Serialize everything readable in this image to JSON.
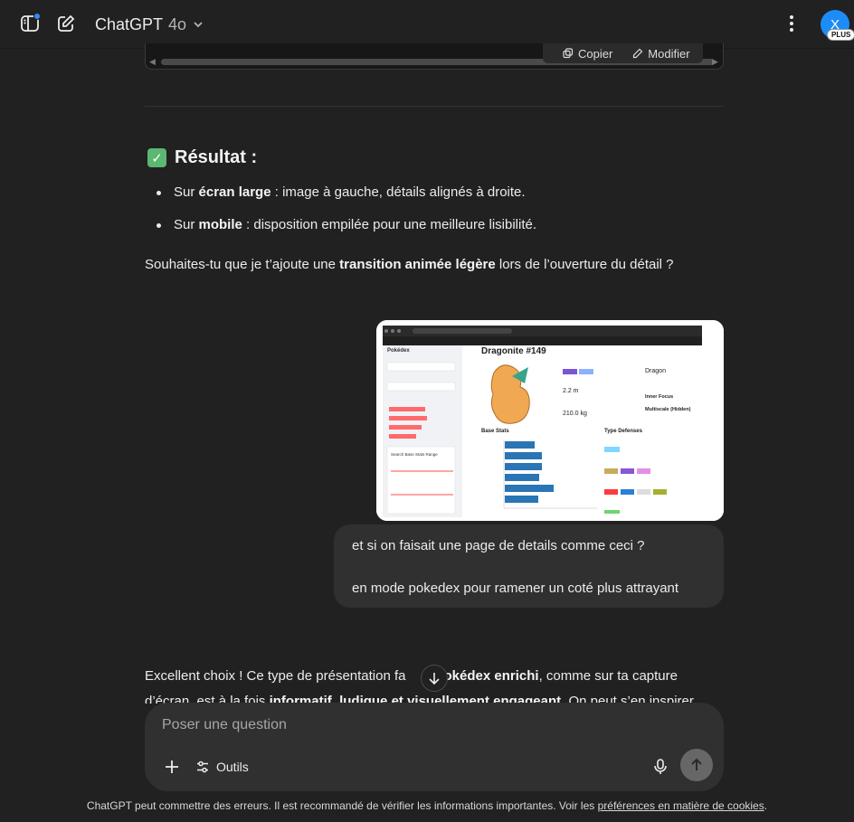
{
  "header": {
    "model_name": "ChatGPT",
    "model_version": "4o",
    "avatar_letter": "X",
    "plan_badge": "PLUS"
  },
  "code_actions": {
    "copy_label": "Copier",
    "edit_label": "Modifier"
  },
  "assistant_message": {
    "result_heading": "Résultat :",
    "bullets": [
      {
        "prefix": "Sur ",
        "bold": "écran large",
        "suffix": " : image à gauche, détails alignés à droite."
      },
      {
        "prefix": "Sur ",
        "bold": "mobile",
        "suffix": " : disposition empilée pour une meilleure lisibilité."
      }
    ],
    "question_prefix": "Souhaites-tu que je t’ajoute une ",
    "question_bold": "transition animée légère",
    "question_suffix": " lors de l’ouverture du détail ?"
  },
  "user_attachment": {
    "app_title": "Pokédex",
    "pokemon_name": "Dragonite #149",
    "height_value": "2.2 m",
    "weight_value": "210.0 kg",
    "species_value": "Dragon",
    "ability_1": "Inner Focus",
    "ability_2": "Multiscale (Hidden)",
    "base_stats_title": "Base Stats",
    "type_defenses_title": "Type Defenses",
    "search_title": "Search Base Stats Range"
  },
  "user_message": {
    "line1": "et si on faisait une page de details comme ceci ?",
    "line2": "en mode pokedex pour ramener un coté plus attrayant"
  },
  "answer": {
    "part1": "Excellent choix ! Ce type de présentation fa",
    "bold1": "Pokédex enrichi",
    "part2": ", comme sur ta capture d’écran, est à la fois ",
    "bold2": "informatif, ludique et visuellement engageant",
    "part3": ". On peut s’en inspirer"
  },
  "composer": {
    "placeholder": "Poser une question",
    "tools_label": "Outils"
  },
  "footer": {
    "text": "ChatGPT peut commettre des erreurs. Il est recommandé de vérifier les informations importantes. Voir les ",
    "link": "préférences en matière de cookies",
    "end": "."
  }
}
